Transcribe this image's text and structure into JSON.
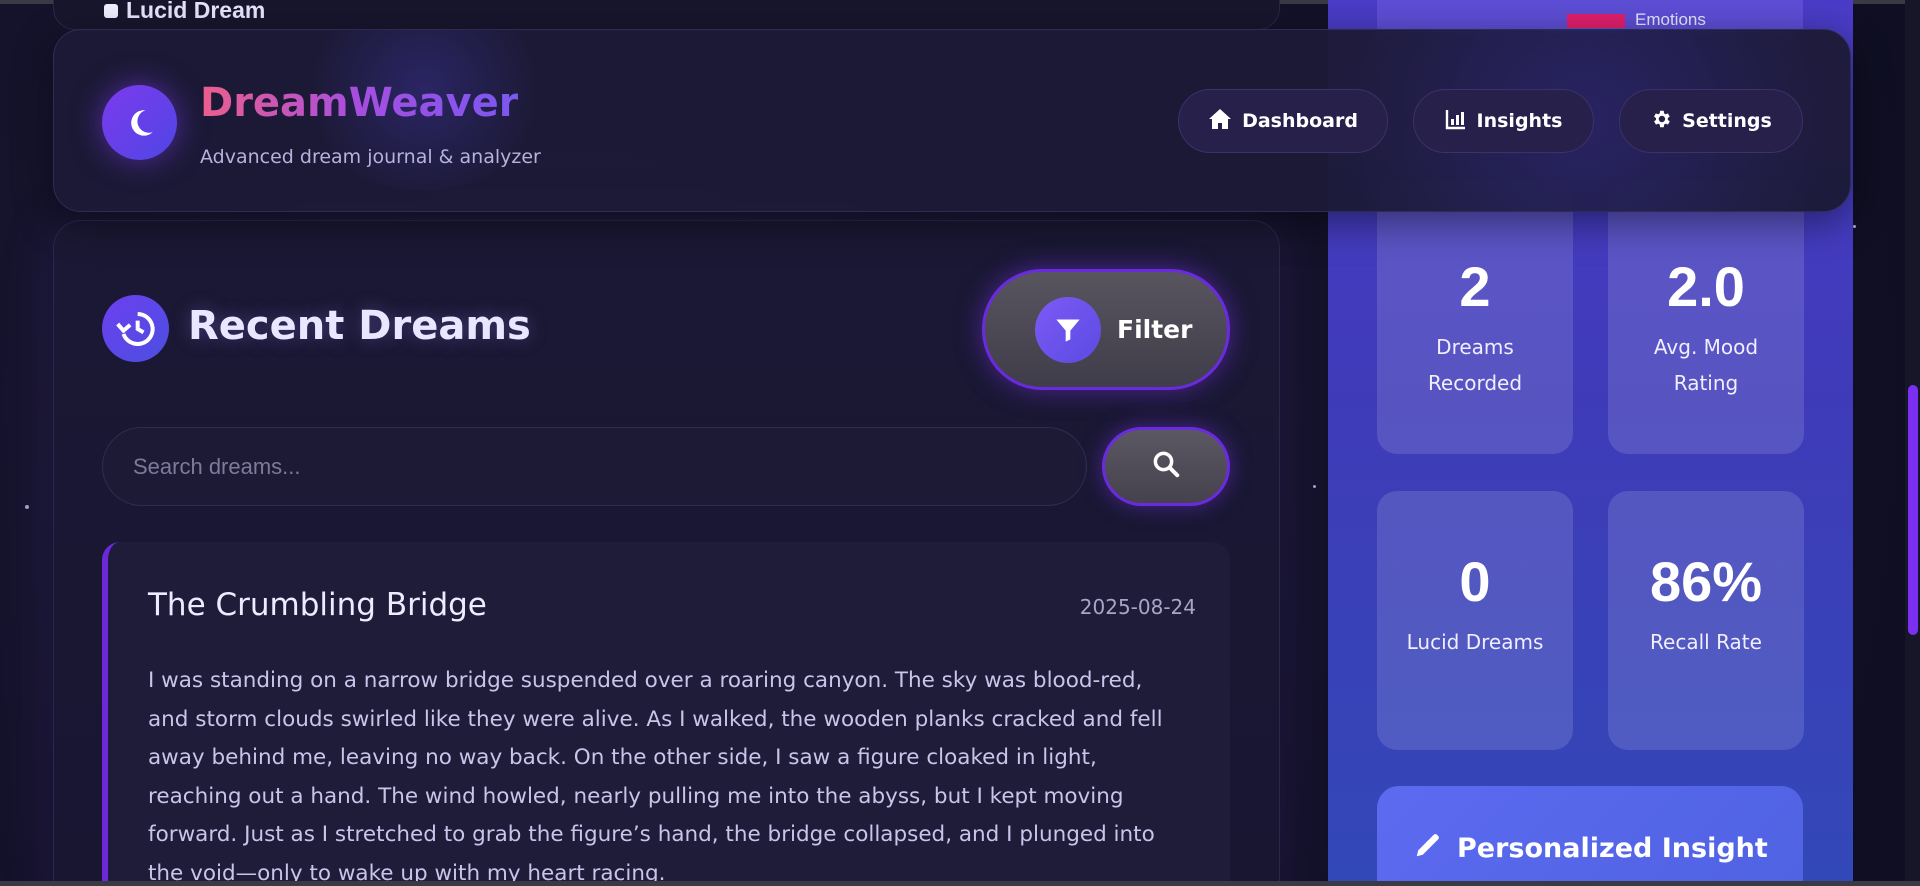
{
  "header": {
    "brand": "DreamWeaver",
    "tagline": "Advanced dream journal & analyzer",
    "nav": [
      {
        "label": "Dashboard",
        "icon": "home-icon"
      },
      {
        "label": "Insights",
        "icon": "chart-bar-icon"
      },
      {
        "label": "Settings",
        "icon": "gear-icon"
      }
    ]
  },
  "upper_card": {
    "partial_label": "Lucid Dream"
  },
  "recent": {
    "title": "Recent Dreams",
    "filter_label": "Filter",
    "search_placeholder": "Search dreams...",
    "dreams": [
      {
        "title": "The Crumbling Bridge",
        "date": "2025-08-24",
        "text": "I was standing on a narrow bridge suspended over a roaring canyon. The sky was blood-red, and storm clouds swirled like they were alive. As I walked, the wooden planks cracked and fell away behind me, leaving no way back. On the other side, I saw a figure cloaked in light, reaching out a hand. The wind howled, nearly pulling me into the abyss, but I kept moving forward. Just as I stretched to grab the figure’s hand, the bridge collapsed, and I plunged into the void—only to wake up with my heart racing."
      }
    ]
  },
  "sidebar": {
    "chart_legend": {
      "label": "Emotions",
      "color": "#e21f6e"
    },
    "stats": [
      {
        "value": "2",
        "label": "Dreams Recorded"
      },
      {
        "value": "2.0",
        "label": "Avg. Mood Rating"
      },
      {
        "value": "0",
        "label": "Lucid Dreams"
      },
      {
        "value": "86%",
        "label": "Recall Rate"
      }
    ],
    "insight_title": "Personalized Insight"
  },
  "colors": {
    "accent": "#7c3aed",
    "sidebar": "#4a3cc8",
    "background": "#15132a"
  }
}
